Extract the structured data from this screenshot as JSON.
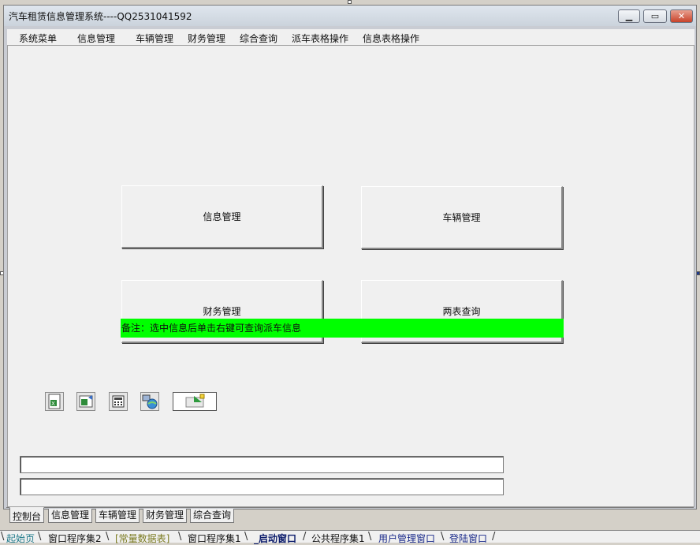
{
  "window": {
    "title": "汽车租赁信息管理系统----QQ2531041592",
    "minimize_icon": "minimize-icon",
    "maximize_icon": "maximize-icon",
    "close_icon": "close-icon"
  },
  "menu": [
    "系统菜单",
    "信息管理",
    "车辆管理",
    "财务管理",
    "综合查询",
    "派车表格操作",
    "信息表格操作"
  ],
  "buttons": {
    "info": "信息管理",
    "vehicle": "车辆管理",
    "finance": "财务管理",
    "two_table": "两表查询"
  },
  "note": {
    "text": "备注：选中信息后单击右键可查询派车信息",
    "color": "#00ff00"
  },
  "toolbar_icons": [
    "excel-export-icon",
    "excel-import-icon",
    "calculator-icon",
    "network-icon",
    "import-arrow-icon"
  ],
  "inner_tabs": [
    "控制台",
    "信息管理",
    "车辆管理",
    "财务管理",
    "综合查询"
  ],
  "bottom_tabs": [
    "起始页",
    "窗口程序集2",
    "[常量数据表]",
    "窗口程序集1",
    "_启动窗口",
    "公共程序集1",
    "用户管理窗口",
    "登陆窗口"
  ]
}
